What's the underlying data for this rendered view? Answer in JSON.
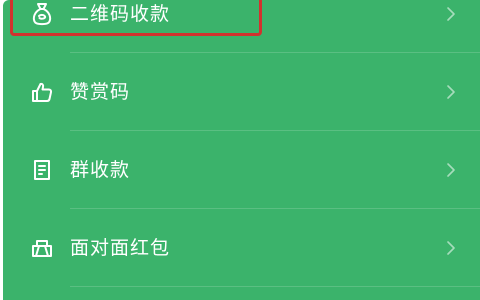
{
  "menu": {
    "items": [
      {
        "label": "二维码收款",
        "icon": "money-bag-icon"
      },
      {
        "label": "赞赏码",
        "icon": "thumbs-up-icon"
      },
      {
        "label": "群收款",
        "icon": "group-receipt-icon"
      },
      {
        "label": "面对面红包",
        "icon": "red-packet-icon"
      }
    ]
  },
  "colors": {
    "background": "#3bb36b",
    "text": "#ffffff",
    "highlight": "#d2322e"
  }
}
